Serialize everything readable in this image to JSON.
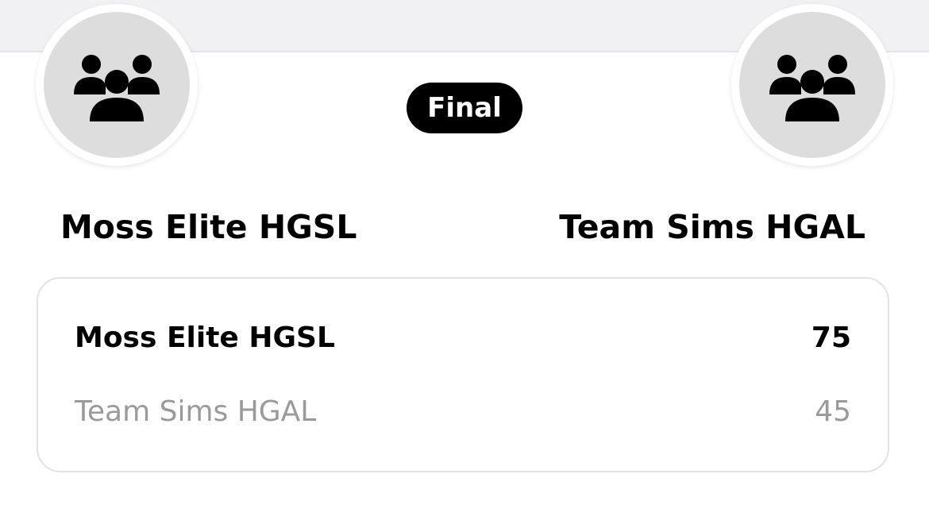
{
  "game": {
    "status": "Final",
    "home": {
      "name": "Moss Elite HGSL",
      "avatar_icon": "group-icon"
    },
    "away": {
      "name": "Team Sims HGAL",
      "avatar_icon": "group-icon"
    }
  },
  "scoreboard": {
    "rows": [
      {
        "team": "Moss Elite HGSL",
        "score": "75",
        "winner": true
      },
      {
        "team": "Team Sims HGAL",
        "score": "45",
        "winner": false
      }
    ]
  },
  "colors": {
    "header_band": "#f1f1f4",
    "avatar_bg": "#dddddd",
    "pill_bg": "#000000",
    "loser_text": "#9a9a9a"
  }
}
